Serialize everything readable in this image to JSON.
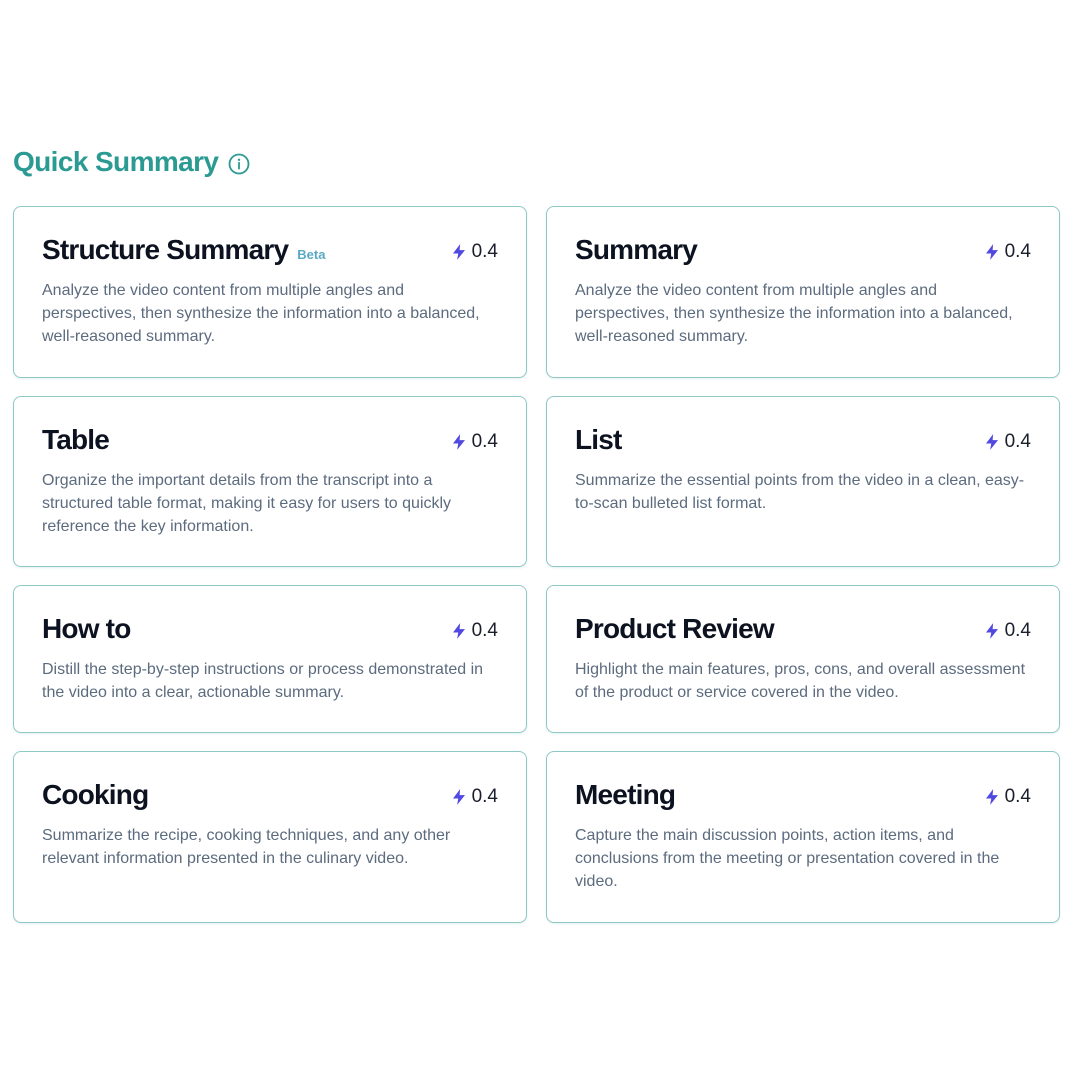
{
  "section": {
    "title": "Quick Summary",
    "info_icon": "info-circle-icon"
  },
  "cost_icon": "lightning-bolt-icon",
  "colors": {
    "accent": "#2a9a93",
    "card_border": "#8fc9c6",
    "bolt": "#5148e0",
    "beta": "#5aa9c4",
    "title_text": "#0c1220",
    "description_text": "#5c6b7e"
  },
  "cards": [
    {
      "title": "Structure Summary",
      "badge": "Beta",
      "cost": "0.4",
      "description": "Analyze the video content from multiple angles and perspectives, then synthesize the information into a balanced, well-reasoned summary."
    },
    {
      "title": "Summary",
      "cost": "0.4",
      "description": "Analyze the video content from multiple angles and perspectives, then synthesize the information into a balanced, well-reasoned summary."
    },
    {
      "title": "Table",
      "cost": "0.4",
      "description": "Organize the important details from the transcript into a structured table format, making it easy for users to quickly reference the key information."
    },
    {
      "title": "List",
      "cost": "0.4",
      "description": "Summarize the essential points from the video in a clean, easy-to-scan bulleted list format."
    },
    {
      "title": "How to",
      "cost": "0.4",
      "description": "Distill the step-by-step instructions or process demonstrated in the video into a clear, actionable summary."
    },
    {
      "title": "Product Review",
      "cost": "0.4",
      "description": "Highlight the main features, pros, cons, and overall assessment of the product or service covered in the video."
    },
    {
      "title": "Cooking",
      "cost": "0.4",
      "description": "Summarize the recipe, cooking techniques, and any other relevant information presented in the culinary video."
    },
    {
      "title": "Meeting",
      "cost": "0.4",
      "description": "Capture the main discussion points, action items, and conclusions from the meeting or presentation covered in the video."
    }
  ]
}
